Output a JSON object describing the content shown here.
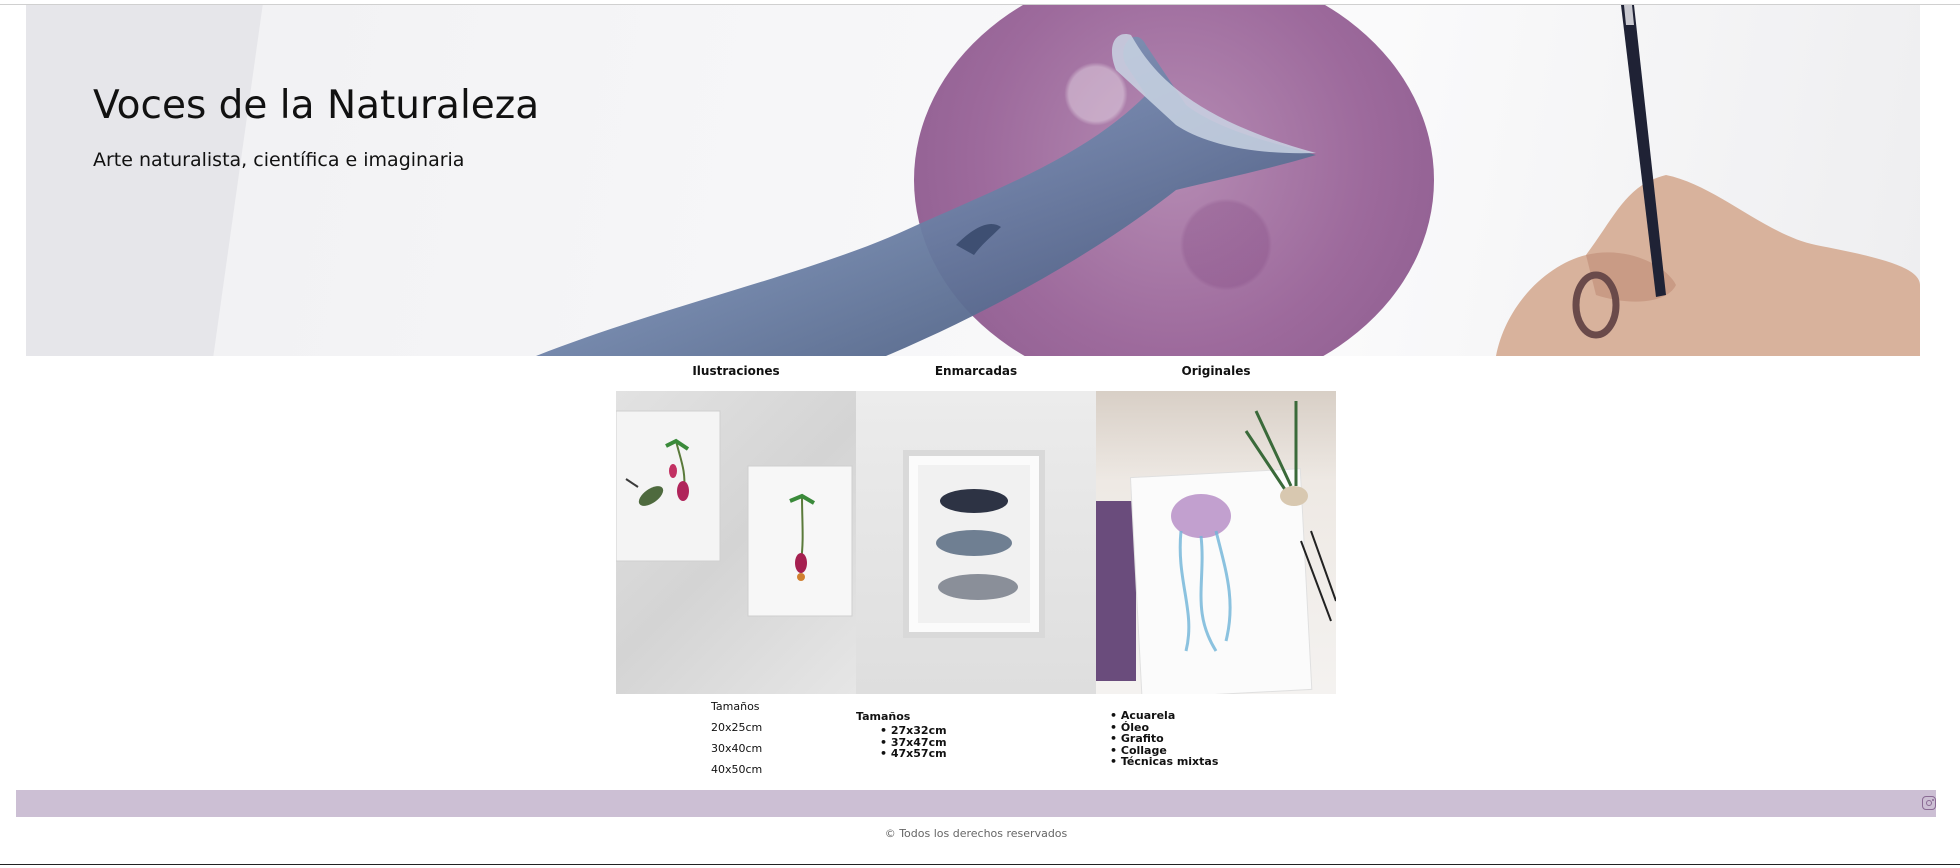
{
  "site": {
    "title": "Voces de la Naturaleza",
    "subtitle": "Arte naturalista, científica e imaginaria"
  },
  "gallery": {
    "columns": [
      {
        "heading": "Ilustraciones",
        "image_alt": "ilustraciones",
        "info": {
          "sizes_label": "Tamaños",
          "sizes": [
            "20x25cm",
            "30x40cm",
            "40x50cm"
          ]
        }
      },
      {
        "heading": "Enmarcadas",
        "image_alt": "enmarcadas",
        "info": {
          "sizes_label": "Tamaños",
          "sizes": [
            "27x32cm",
            "37x47cm",
            "47x57cm"
          ]
        }
      },
      {
        "heading": "Originales",
        "image_alt": "originales",
        "info": {
          "techniques": [
            "Acuarela",
            "Óleo",
            "Grafito",
            "Collage",
            "Técnicas mixtas"
          ]
        }
      }
    ]
  },
  "footer": {
    "copyright": "© Todos los derechos reservados",
    "social_icon": "instagram-icon"
  },
  "colors": {
    "footer_bar": "#ccbfd4",
    "accent_purple": "#9d6a9c"
  }
}
